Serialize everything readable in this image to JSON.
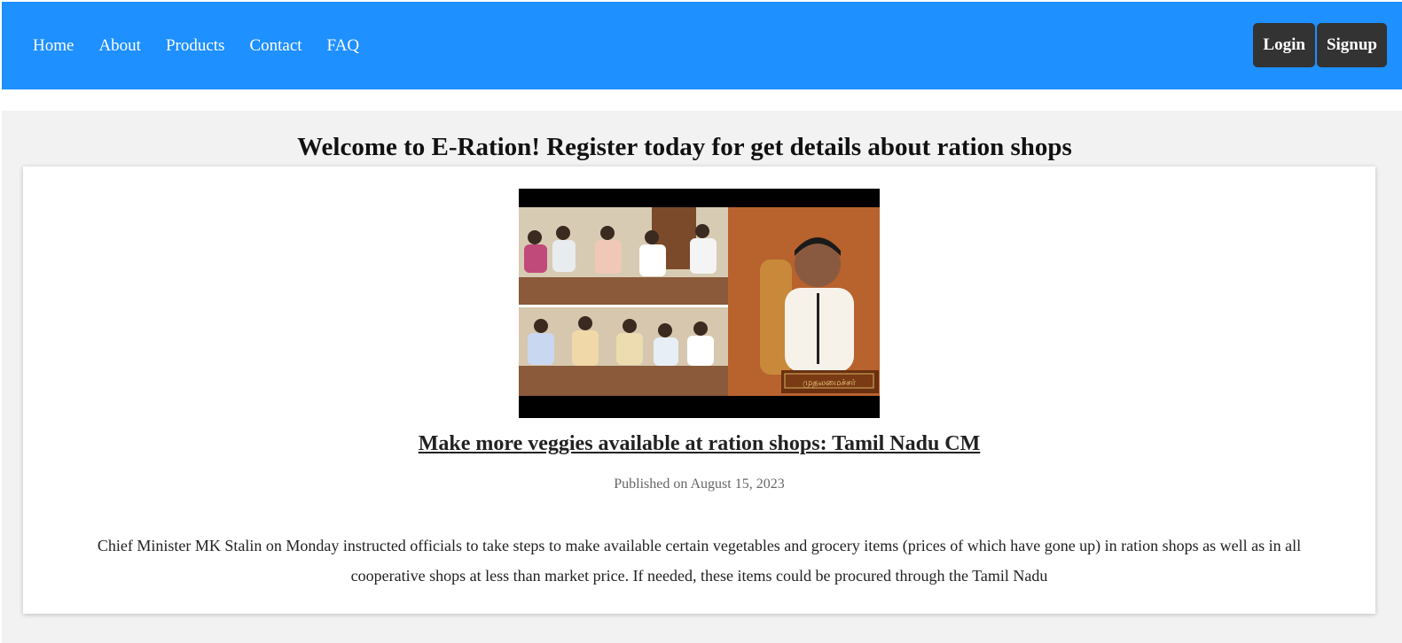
{
  "nav": {
    "links": [
      "Home",
      "About",
      "Products",
      "Contact",
      "FAQ"
    ],
    "login_label": "Login",
    "signup_label": "Signup"
  },
  "colors": {
    "navbar_bg": "#1e90ff",
    "button_bg": "#333333",
    "page_bg": "#f2f2f2"
  },
  "main": {
    "welcome": "Welcome to E-Ration! Register today for get details about ration shops"
  },
  "article": {
    "image_caption_text": "முதலமைச்சர்",
    "title": "Make more veggies available at ration shops: Tamil Nadu CM",
    "date": "Published on August 15, 2023",
    "body": "Chief Minister MK Stalin on Monday instructed officials to take steps to make available certain vegetables and grocery items (prices of which have gone up) in ration shops as well as in all cooperative shops at less than market price. If needed, these items could be procured through the Tamil Nadu"
  }
}
